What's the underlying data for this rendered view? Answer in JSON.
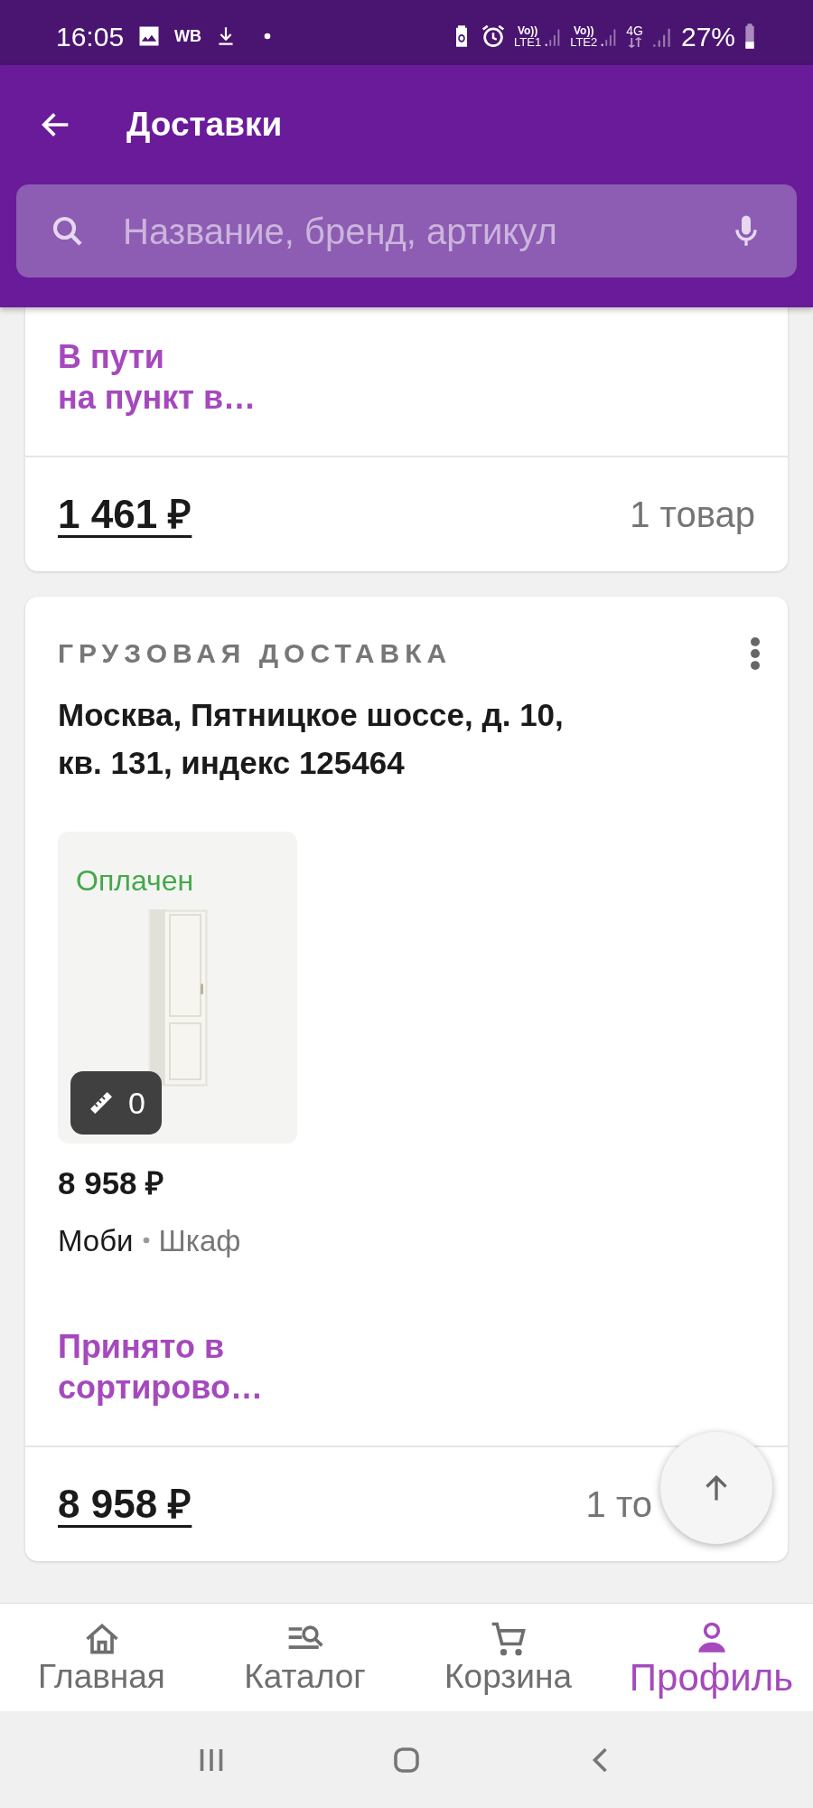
{
  "status_bar": {
    "time": "16:05",
    "notification_text": "WB",
    "sim1": {
      "volte": "Vo))",
      "network": "LTE1"
    },
    "sim2": {
      "volte": "Vo))",
      "network": "LTE2"
    },
    "data_type": "4G",
    "battery": "27%"
  },
  "header": {
    "title": "Доставки",
    "search": {
      "placeholder": "Название, бренд, артикул"
    }
  },
  "deliveries": [
    {
      "status_lines": [
        "В пути",
        "на пункт в…"
      ],
      "total": "1 461 ₽",
      "count": "1 товар"
    },
    {
      "type_label": "ГРУЗОВАЯ ДОСТАВКА",
      "address_lines": [
        "Москва, Пятницкое шоссе, д. 10,",
        "кв. 131, индекс 125464"
      ],
      "items": [
        {
          "kind": "picture",
          "payment": "Оплачен",
          "badge_count": "0",
          "price": "8 958 ₽",
          "brand": "Моби",
          "name": "Шкаф"
        }
      ],
      "status_lines": [
        "Принято в",
        "сортирово…"
      ],
      "total": "8 958 ₽",
      "count": "1 то"
    }
  ],
  "bottom_nav": [
    {
      "label": "Главная",
      "selected": false
    },
    {
      "label": "Каталог",
      "selected": false
    },
    {
      "label": "Корзина",
      "selected": false
    },
    {
      "label": "Профиль",
      "selected": true
    }
  ]
}
